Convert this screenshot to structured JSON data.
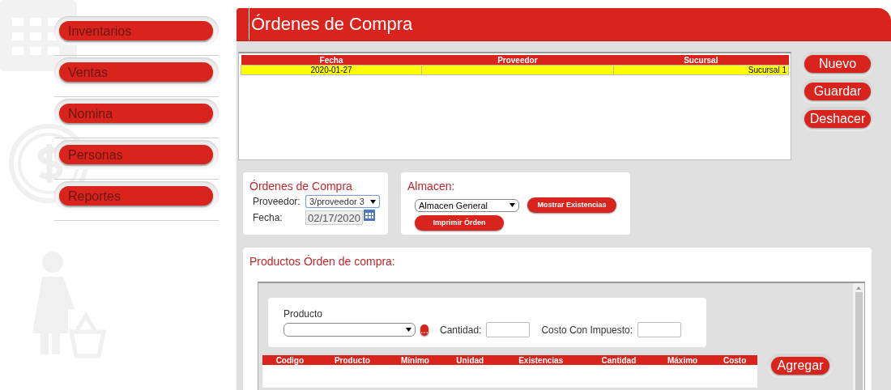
{
  "sidebar": {
    "items": [
      {
        "label": "Inventarios"
      },
      {
        "label": "Ventas"
      },
      {
        "label": "Nomina"
      },
      {
        "label": "Personas"
      },
      {
        "label": "Reportes"
      }
    ]
  },
  "header": {
    "title": "Órdenes de Compra"
  },
  "orders_table": {
    "columns": [
      "Fecha",
      "Proveedor",
      "Sucursal"
    ],
    "rows": [
      {
        "fecha": "2020-01-27",
        "sucursal": "Sucursal 1",
        "selected": true
      }
    ]
  },
  "actions": [
    "Nuevo",
    "Guardar",
    "Deshacer"
  ],
  "order_form": {
    "title": "Órdenes de Compra",
    "fields": [
      {
        "label": "Proveedor:",
        "value": "3/proveedor 3",
        "kind": "select"
      },
      {
        "label": "Fecha:",
        "value": "02/17/2020",
        "kind": "date"
      }
    ]
  },
  "almacen": {
    "title": "Almacen:",
    "select": {
      "value": "Almacen General"
    },
    "buttons": [
      "Mostrar Existencias",
      "Imprimir Órden"
    ]
  },
  "products": {
    "title": "Productos Órden de compra:",
    "product_label": "Producto",
    "browse_button": "...",
    "quantity_label": "Cantidad:",
    "cost_label": "Costo Con Impuesto:",
    "columns": [
      "Codigo",
      "Producto",
      "Mínimo",
      "Unidad",
      "Existencias",
      "Cantidad",
      "Máximo",
      "Costo"
    ],
    "add_button": "Agregar"
  }
}
